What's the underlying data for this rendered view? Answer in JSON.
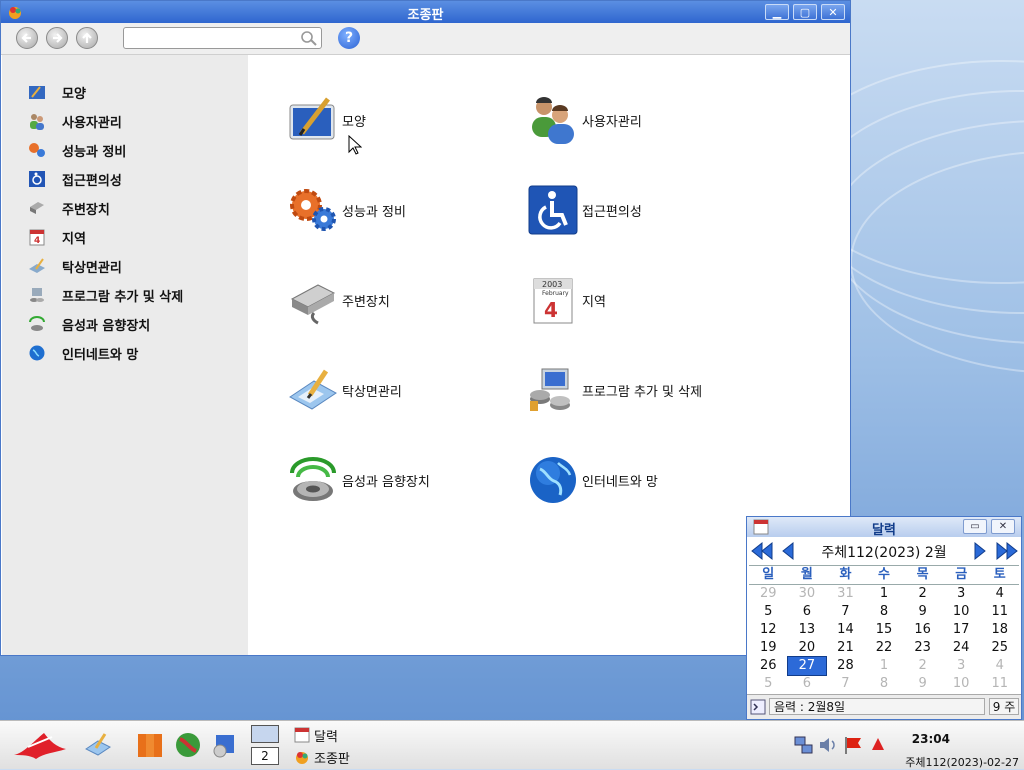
{
  "window": {
    "title": "조종판"
  },
  "sidebar": {
    "items": [
      {
        "label": "모양"
      },
      {
        "label": "사용자관리"
      },
      {
        "label": "성능과 정비"
      },
      {
        "label": "접근편의성"
      },
      {
        "label": "주변장치"
      },
      {
        "label": "지역"
      },
      {
        "label": "탁상면관리"
      },
      {
        "label": "프로그람 추가 및 삭제"
      },
      {
        "label": "음성과 음향장치"
      },
      {
        "label": "인터네트와 망"
      }
    ]
  },
  "content": {
    "items": [
      {
        "label": "모양",
        "icon": "appearance-icon"
      },
      {
        "label": "사용자관리",
        "icon": "users-icon"
      },
      {
        "label": "성능과 정비",
        "icon": "gears-icon"
      },
      {
        "label": "접근편의성",
        "icon": "wheelchair-icon"
      },
      {
        "label": "주변장치",
        "icon": "printer-icon"
      },
      {
        "label": "지역",
        "icon": "calendar-icon"
      },
      {
        "label": "탁상면관리",
        "icon": "desktop-edit-icon"
      },
      {
        "label": "프로그람 추가 및 삭제",
        "icon": "install-programs-icon"
      },
      {
        "label": "음성과 음향장치",
        "icon": "speaker-icon"
      },
      {
        "label": "인터네트와 망",
        "icon": "globe-icon"
      }
    ]
  },
  "calendar": {
    "title": "달력",
    "month_label": "주체112(2023)  2월",
    "weekdays": [
      "일",
      "월",
      "화",
      "수",
      "목",
      "금",
      "토"
    ],
    "weeks": [
      [
        "29",
        "30",
        "31",
        "1",
        "2",
        "3",
        "4"
      ],
      [
        "5",
        "6",
        "7",
        "8",
        "9",
        "10",
        "11"
      ],
      [
        "12",
        "13",
        "14",
        "15",
        "16",
        "17",
        "18"
      ],
      [
        "19",
        "20",
        "21",
        "22",
        "23",
        "24",
        "25"
      ],
      [
        "26",
        "27",
        "28",
        "1",
        "2",
        "3",
        "4"
      ],
      [
        "5",
        "6",
        "7",
        "8",
        "9",
        "10",
        "11"
      ]
    ],
    "lunar": "음력 : 2월8일",
    "week_number": "9 주"
  },
  "taskbar": {
    "pager_number": "2",
    "tasks": [
      {
        "label": "달력"
      },
      {
        "label": "조종판"
      }
    ],
    "clock": "23:04",
    "date": "주체112(2023)-02-27"
  },
  "colors": {
    "accent": "#2f66cf",
    "sidebar_bg": "#ebebeb",
    "selected_day": "#2c6ad8"
  }
}
